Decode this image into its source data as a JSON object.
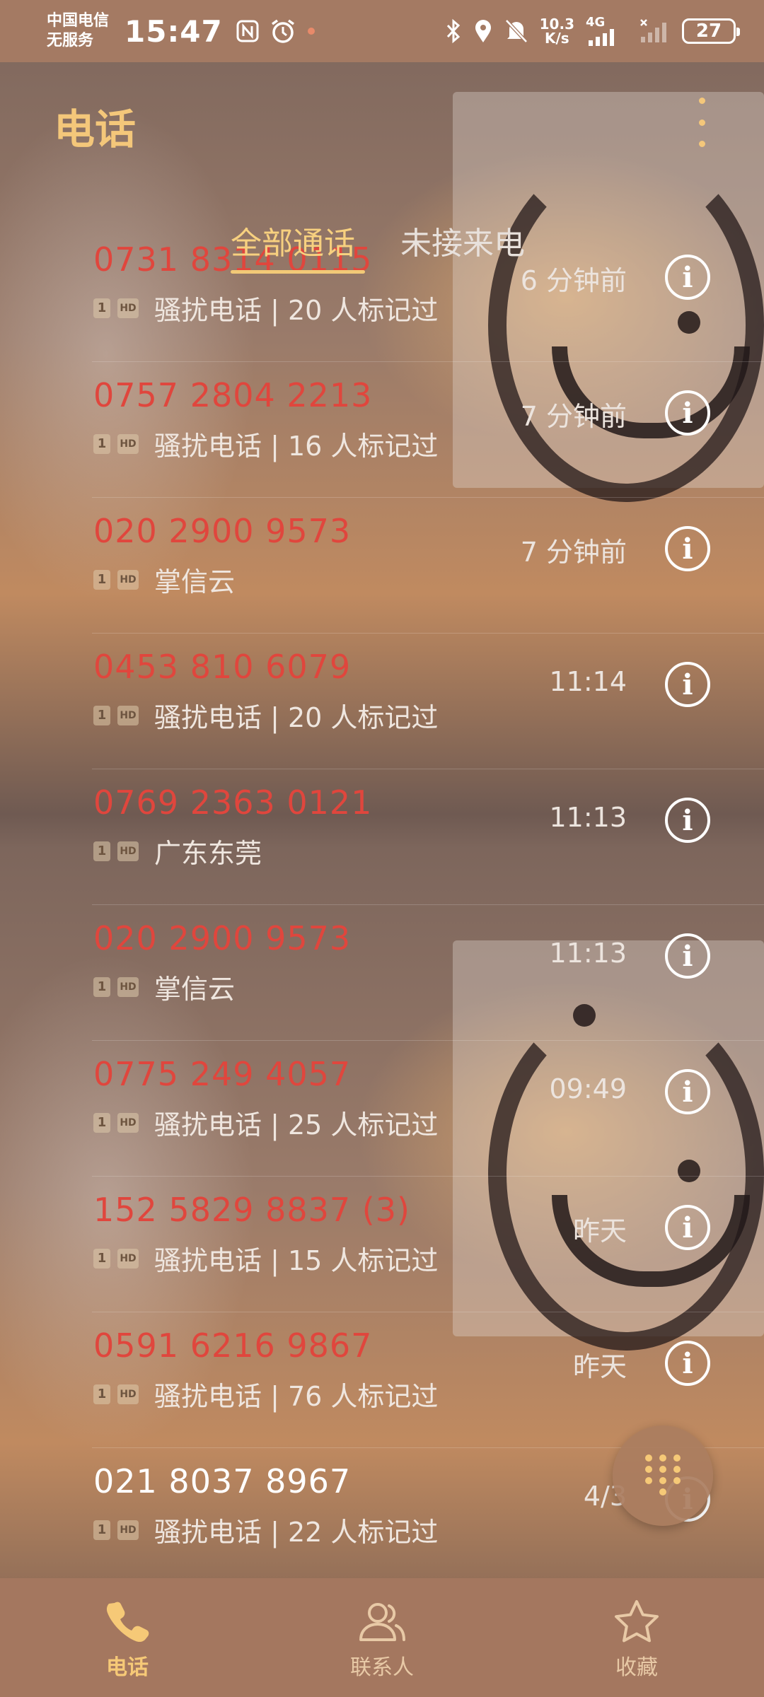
{
  "status_bar": {
    "carrier_line1": "中国电信",
    "carrier_line2": "无服务",
    "time": "15:47",
    "net_speed_value": "10.3",
    "net_speed_unit": "K/s",
    "signal_label": "4G",
    "battery": "27",
    "icons": [
      "nfc-icon",
      "alarm-icon",
      "bluetooth-icon",
      "location-icon",
      "mute-icon",
      "signal-icon",
      "battery-icon"
    ]
  },
  "header": {
    "title": "电话",
    "more_icon": "more-vertical-icon"
  },
  "tabs": [
    {
      "label": "全部通话",
      "active": true
    },
    {
      "label": "未接来电",
      "active": false
    }
  ],
  "calls": [
    {
      "number": "0731 8314 0115",
      "sim": "1",
      "hd": "HD",
      "label": "骚扰电话 | 20 人标记过",
      "time": "6 分钟前",
      "missed": true
    },
    {
      "number": "0757 2804 2213",
      "sim": "1",
      "hd": "HD",
      "label": "骚扰电话 | 16 人标记过",
      "time": "7 分钟前",
      "missed": true
    },
    {
      "number": "020 2900 9573",
      "sim": "1",
      "hd": "HD",
      "label": "掌信云",
      "time": "7 分钟前",
      "missed": true
    },
    {
      "number": "0453 810 6079",
      "sim": "1",
      "hd": "HD",
      "label": "骚扰电话 | 20 人标记过",
      "time": "11:14",
      "missed": true
    },
    {
      "number": "0769 2363 0121",
      "sim": "1",
      "hd": "HD",
      "label": "广东东莞",
      "time": "11:13",
      "missed": true
    },
    {
      "number": "020 2900 9573",
      "sim": "1",
      "hd": "HD",
      "label": "掌信云",
      "time": "11:13",
      "missed": true
    },
    {
      "number": "0775 249 4057",
      "sim": "1",
      "hd": "HD",
      "label": "骚扰电话 | 25 人标记过",
      "time": "09:49",
      "missed": true
    },
    {
      "number": "152 5829 8837 (3)",
      "sim": "1",
      "hd": "HD",
      "label": "骚扰电话 | 15 人标记过",
      "time": "昨天",
      "missed": true
    },
    {
      "number": "0591 6216 9867",
      "sim": "1",
      "hd": "HD",
      "label": "骚扰电话 | 76 人标记过",
      "time": "昨天",
      "missed": true
    },
    {
      "number": "021 8037 8967",
      "sim": "1",
      "hd": "HD",
      "label": "骚扰电话 | 22 人标记过",
      "time": "4/3",
      "missed": false
    }
  ],
  "dialpad": {
    "icon": "dialpad-icon"
  },
  "bottom_nav": [
    {
      "label": "电话",
      "icon": "phone-icon",
      "active": true
    },
    {
      "label": "联系人",
      "icon": "contacts-icon",
      "active": false
    },
    {
      "label": "收藏",
      "icon": "star-icon",
      "active": false
    }
  ],
  "colors": {
    "accent": "#f4c77a",
    "missed": "#e0463d",
    "status_bar_bg": "#a47a63",
    "nav_bg": "#a4775f"
  }
}
